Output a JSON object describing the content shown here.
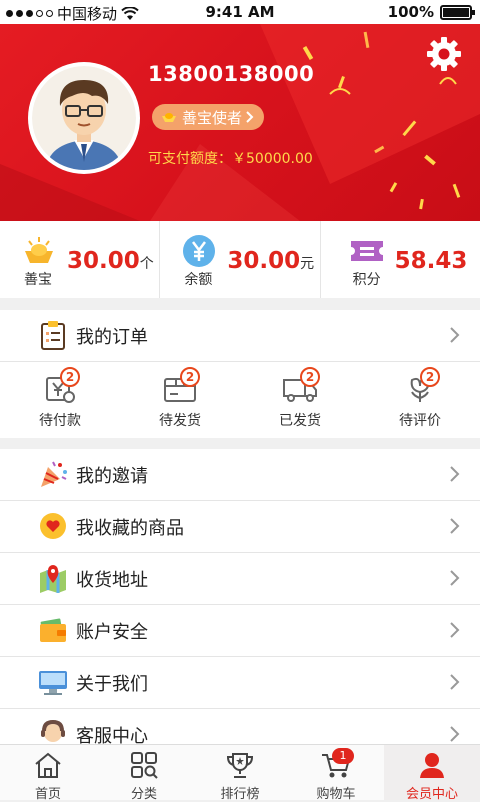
{
  "status_bar": {
    "carrier": "中国移动",
    "time": "9:41 AM",
    "battery": "100%"
  },
  "profile": {
    "phone": "13800138000",
    "level": "善宝使者",
    "credit": "可支付额度：￥50000.00"
  },
  "stats": [
    {
      "icon": "gold-ingot-icon",
      "label": "善宝",
      "value": "30.00",
      "unit": "个"
    },
    {
      "icon": "yen-coin-icon",
      "label": "余额",
      "value": "30.00",
      "unit": "元"
    },
    {
      "icon": "ticket-icon",
      "label": "积分",
      "value": "58.43",
      "unit": ""
    }
  ],
  "orders": {
    "title": "我的订单",
    "items": [
      {
        "label": "待付款",
        "count": "2",
        "icon": "payment-icon"
      },
      {
        "label": "待发货",
        "count": "2",
        "icon": "package-icon"
      },
      {
        "label": "已发货",
        "count": "2",
        "icon": "truck-icon"
      },
      {
        "label": "待评价",
        "count": "2",
        "icon": "flower-icon"
      }
    ]
  },
  "menu": [
    {
      "label": "我的邀请",
      "icon": "party-popper-icon"
    },
    {
      "label": "我收藏的商品",
      "icon": "heart-icon"
    },
    {
      "label": "收货地址",
      "icon": "map-pin-icon"
    },
    {
      "label": "账户安全",
      "icon": "wallet-icon"
    },
    {
      "label": "关于我们",
      "icon": "monitor-icon"
    },
    {
      "label": "客服中心",
      "icon": "service-avatar-icon"
    }
  ],
  "tabbar": [
    {
      "label": "首页",
      "icon": "home-icon"
    },
    {
      "label": "分类",
      "icon": "category-icon"
    },
    {
      "label": "排行榜",
      "icon": "trophy-icon"
    },
    {
      "label": "购物车",
      "icon": "cart-icon",
      "badge": "1"
    },
    {
      "label": "会员中心",
      "icon": "member-icon",
      "active": true
    }
  ],
  "colors": {
    "brand_red": "#e0261d",
    "credit_yellow": "#ffd84a",
    "badge_orange": "#f4a26a"
  }
}
